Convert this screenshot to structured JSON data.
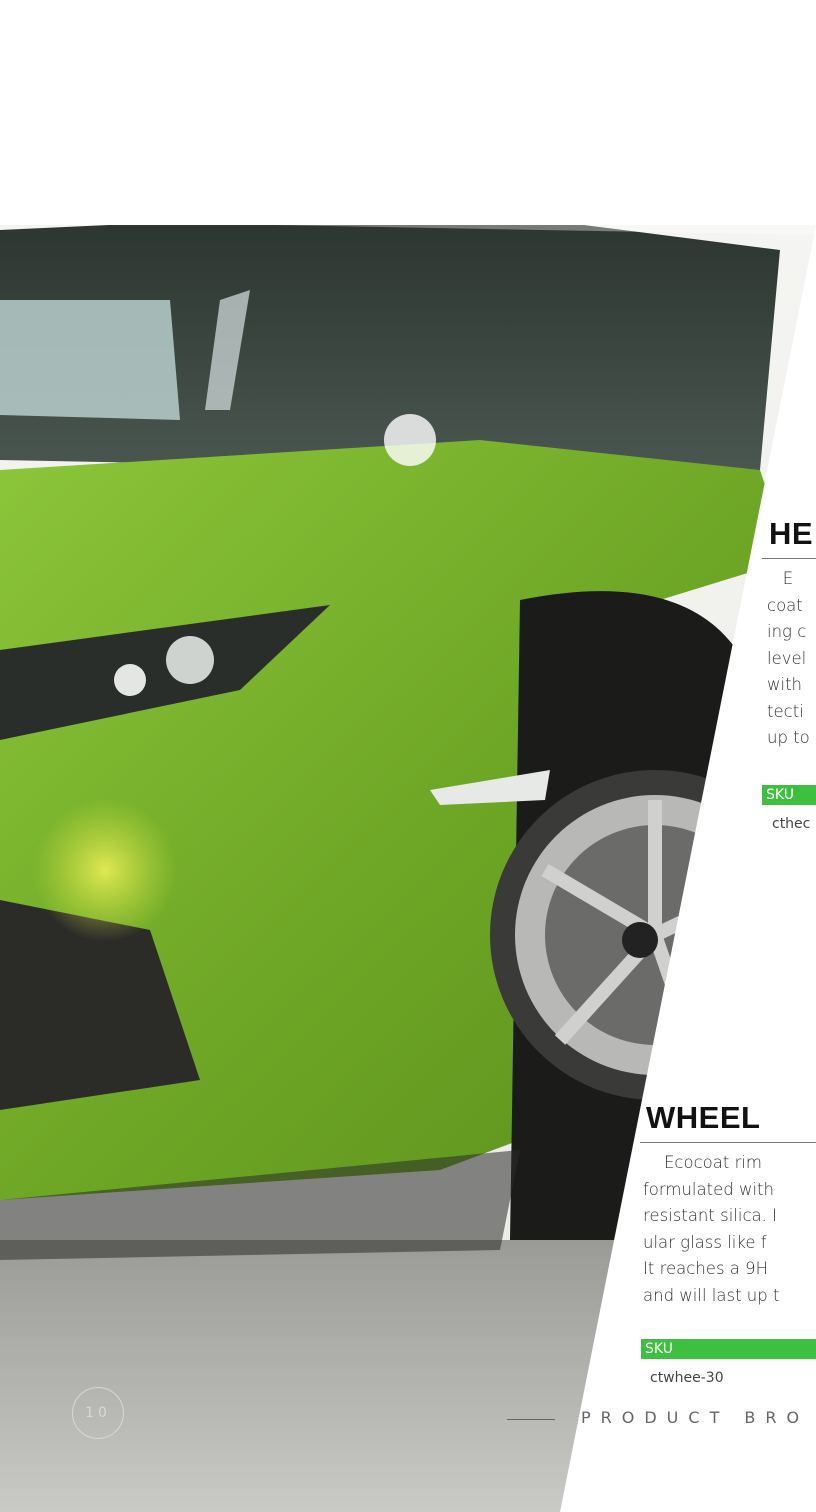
{
  "page_number": "10",
  "footer": {
    "label": "PRODUCT BRO"
  },
  "sections": [
    {
      "title": "HE",
      "lines": [
        "   E",
        "coat",
        "ing c",
        "level",
        "with",
        "tecti",
        "up to"
      ],
      "sku_label": "SKU",
      "sku_code": "cthec"
    },
    {
      "title": "WHEEL",
      "lines": [
        "    Ecocoat rim",
        "formulated with",
        "resistant silica. I",
        "ular glass like f",
        "It reaches a 9H",
        "and will last up t"
      ],
      "sku_label": "SKU",
      "sku_code": "ctwhee-30"
    }
  ],
  "colors": {
    "accent_green": "#3fbf3f",
    "car_green": "#7fb52a"
  }
}
